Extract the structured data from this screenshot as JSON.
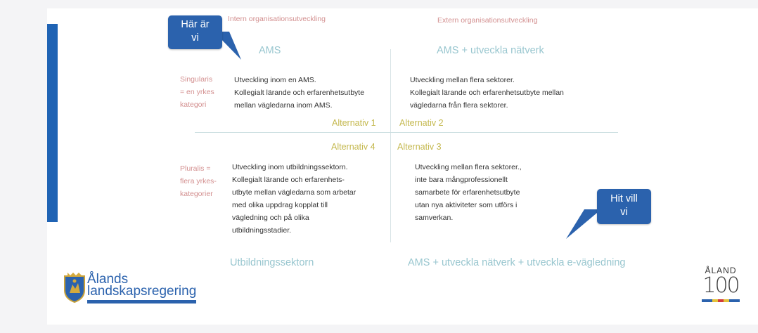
{
  "header": {
    "internal": "Intern organisationsutveckling",
    "external": "Extern organisationsutveckling"
  },
  "quadrants": {
    "top_left_title": "AMS",
    "top_right_title": "AMS + utveckla nätverk",
    "bottom_left_title": "Utbildningssektorn",
    "bottom_right_title": "AMS + utveckla nätverk + utveckla e-vägledning"
  },
  "row_labels": {
    "singular": [
      "Singularis",
      "= en yrkes",
      "kategori"
    ],
    "plural": [
      "Pluralis =",
      "flera yrkes-",
      "kategorier"
    ]
  },
  "text": {
    "top_left": [
      "Utveckling inom en AMS.",
      "Kollegialt lärande och erfarenhetsutbyte",
      "mellan vägledarna inom AMS."
    ],
    "top_right": [
      "Utveckling mellan flera sektorer.",
      "Kollegialt lärande och erfarenhetsutbyte mellan",
      "vägledarna från flera sektorer."
    ],
    "bottom_left": [
      "Utveckling inom utbildningssektorn.",
      "Kollegialt lärande och erfarenhets-",
      "utbyte mellan vägledarna som arbetar",
      "med olika uppdrag kopplat till",
      "vägledning och på olika",
      "utbildningsstadier."
    ],
    "bottom_right": [
      "Utveckling mellan flera sektorer.,",
      "inte bara mångprofessionellt",
      "samarbete för erfarenhetsutbyte",
      "utan nya aktiviteter som utförs i",
      "samverkan."
    ]
  },
  "alternatives": {
    "alt1": "Alternativ 1",
    "alt2": "Alternativ 2",
    "alt3": "Alternativ 3",
    "alt4": "Alternativ 4"
  },
  "callouts": {
    "here": [
      "Här är",
      "vi"
    ],
    "goal": [
      "Hit vill",
      "vi"
    ]
  },
  "logos": {
    "aland_gov": [
      "Ålands",
      "landskapsregering"
    ],
    "aland100_top": "ÅLAND",
    "aland100_num": "100"
  },
  "colors": {
    "accent_blue": "#2b62ad",
    "header_pink": "#d39090",
    "title_teal": "#98c6cf",
    "alt_yellow": "#c4b84e"
  }
}
